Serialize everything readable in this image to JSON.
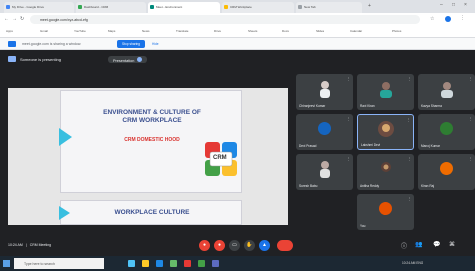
{
  "browser": {
    "tabs": [
      {
        "label": "My Drive - Google Drive"
      },
      {
        "label": "Dashboard - CRM"
      },
      {
        "label": "Meet - Environment"
      },
      {
        "label": "CRM Workplace"
      },
      {
        "label": "New Tab"
      }
    ],
    "url": "meet.google.com/xyz-abcd-efg",
    "bookmarks": [
      "Apps",
      "Gmail",
      "YouTube",
      "Maps",
      "News",
      "Translate",
      "Drive",
      "Sheets",
      "Docs",
      "Slides",
      "Calendar",
      "Photos"
    ],
    "share_banner": "meet.google.com is sharing a window.",
    "stop_sharing": "Stop sharing",
    "hide": "Hide"
  },
  "meet": {
    "presenting_label": "Someone is presenting",
    "presenter_chip": "Presentation",
    "meeting_time": "10:24 AM",
    "meeting_code": "CRM Meeting"
  },
  "slide": {
    "title_line1": "ENVIRONMENT & CULTURE OF",
    "title_line2": "CRM WORKPLACE",
    "subtitle": "CRM DOMESTIC HOOD",
    "logo_text": "CRM",
    "next_title": "WORKPLACE CULTURE"
  },
  "participants": [
    {
      "name": "Chiranjeevi Kumar"
    },
    {
      "name": "Ravi Kiran"
    },
    {
      "name": "Kavya Sharma"
    },
    {
      "name": "Devi Prasad"
    },
    {
      "name": "Lakshmi Devi"
    },
    {
      "name": "Manoj Kumar"
    },
    {
      "name": "Suresh Babu"
    },
    {
      "name": "Anitha Reddy"
    },
    {
      "name": "Kiran Raj"
    },
    {
      "name": "You"
    }
  ],
  "taskbar": {
    "search_placeholder": "Type here to search",
    "tray": "10:24 AM  ENG"
  },
  "colors": {
    "meet_bg": "#202124",
    "tile_bg": "#3c4043",
    "accent_blue": "#1a73e8",
    "end_call_red": "#ea4335",
    "slide_title": "#3a4f8f",
    "slide_subtitle": "#d9332f",
    "slide_arrow": "#39bfe0"
  }
}
